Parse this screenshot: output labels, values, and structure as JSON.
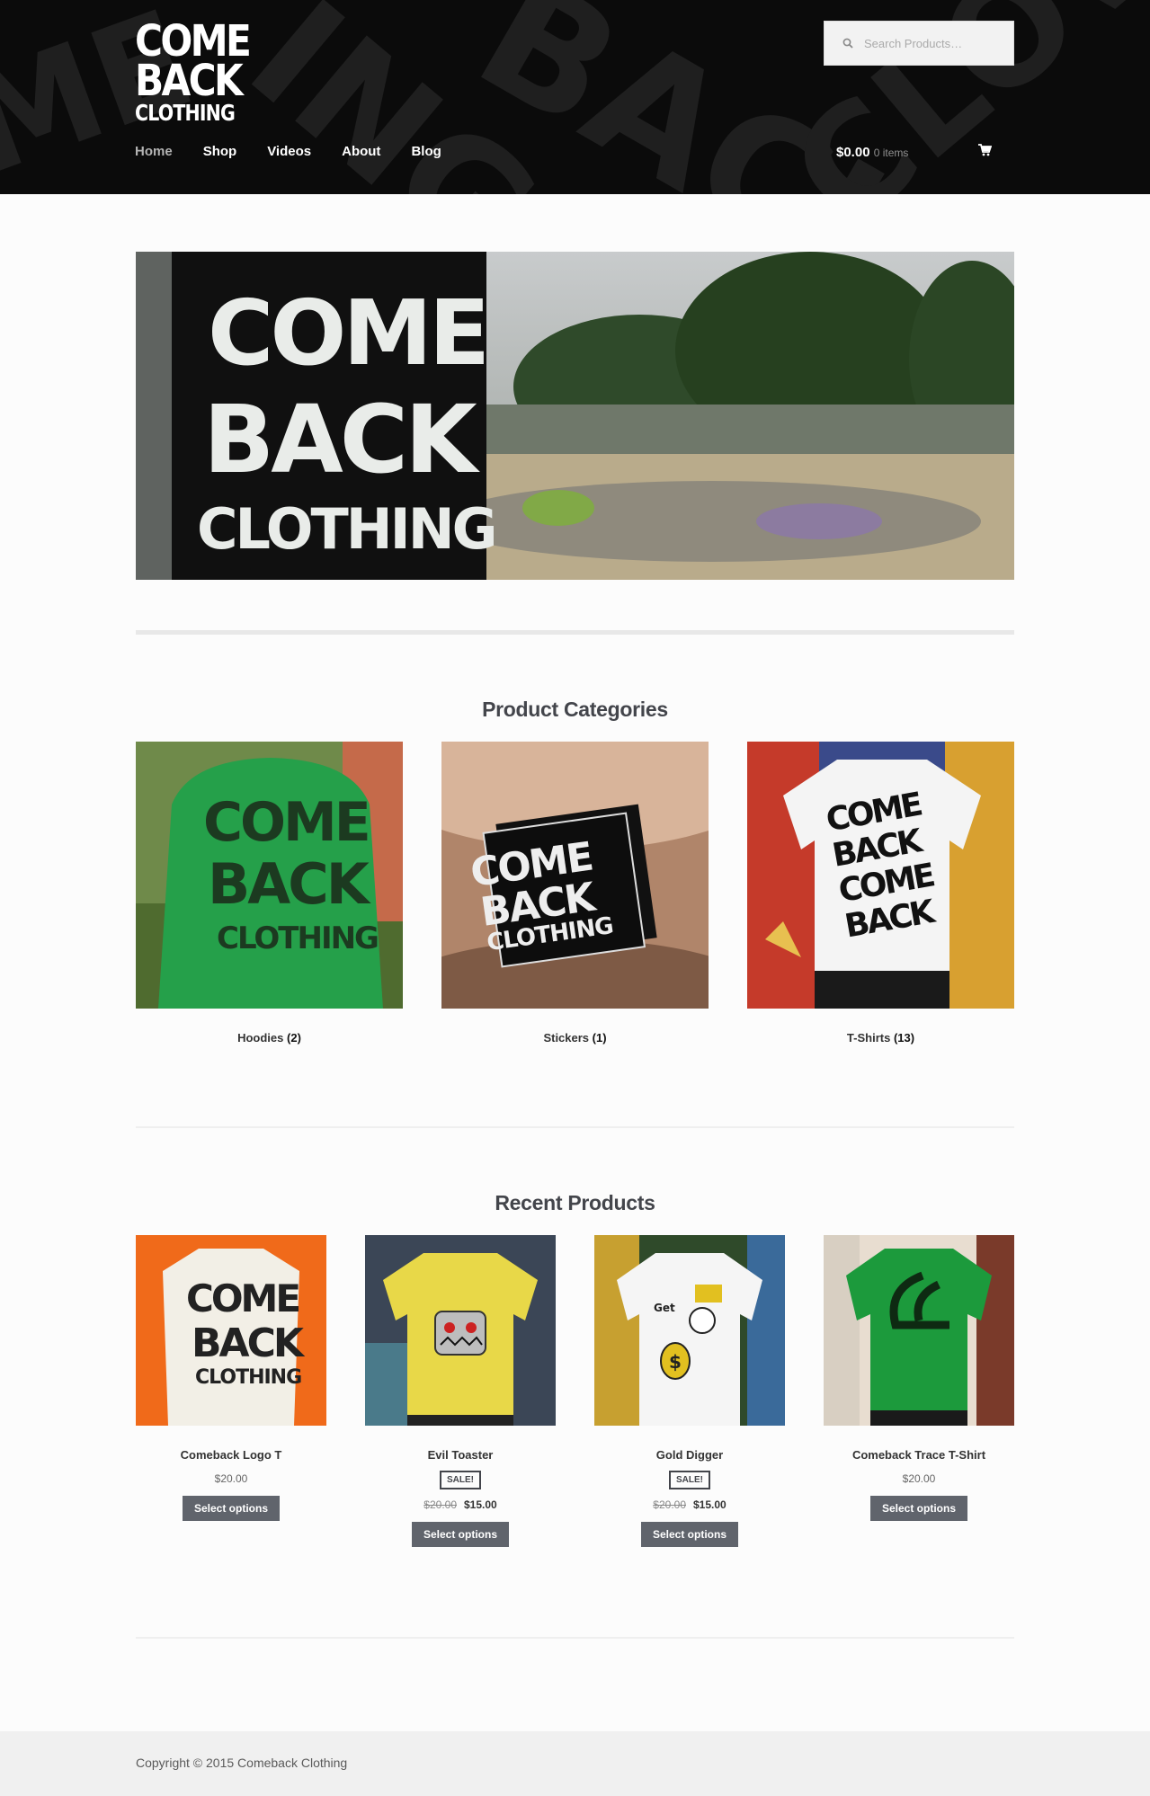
{
  "header": {
    "logo": {
      "line1": "COME",
      "line2": "BACK",
      "line3": "CLOTHING"
    },
    "search": {
      "placeholder": "Search Products…"
    },
    "nav": [
      {
        "label": "Home",
        "active": true
      },
      {
        "label": "Shop"
      },
      {
        "label": "Videos"
      },
      {
        "label": "About"
      },
      {
        "label": "Blog"
      }
    ],
    "cart": {
      "total": "$0.00",
      "items": "0 items"
    }
  },
  "hero": {
    "sign_line1": "COME",
    "sign_line2": "BACK",
    "sign_line3": "CLOTHING"
  },
  "categories": {
    "title": "Product Categories",
    "items": [
      {
        "name": "Hoodies",
        "count": "(2)"
      },
      {
        "name": "Stickers",
        "count": "(1)"
      },
      {
        "name": "T-Shirts",
        "count": "(13)"
      }
    ]
  },
  "recent": {
    "title": "Recent Products",
    "items": [
      {
        "name": "Comeback Logo T",
        "price": "$20.00",
        "button": "Select options"
      },
      {
        "name": "Evil Toaster",
        "sale_badge": "SALE!",
        "old_price": "$20.00",
        "new_price": "$15.00",
        "button": "Select options"
      },
      {
        "name": "Gold Digger",
        "sale_badge": "SALE!",
        "old_price": "$20.00",
        "new_price": "$15.00",
        "button": "Select options"
      },
      {
        "name": "Comeback Trace T-Shirt",
        "price": "$20.00",
        "button": "Select options"
      }
    ]
  },
  "footer": {
    "copyright": "Copyright © 2015 Comeback Clothing"
  },
  "colors": {
    "header_bg": "#0b0b0b",
    "button_bg": "#60646c",
    "text": "#43454b"
  }
}
